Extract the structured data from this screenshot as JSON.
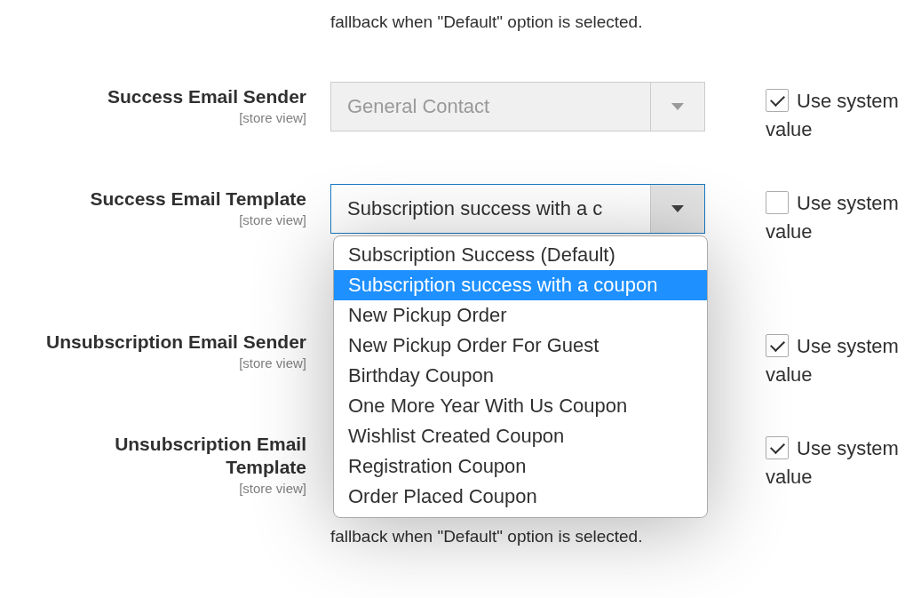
{
  "top_note": "fallback when \"Default\" option is selected.",
  "fields": [
    {
      "label": "Success Email Sender",
      "scope": "[store view]",
      "select": {
        "value": "General Contact",
        "disabled": true,
        "expanded": false
      },
      "use_system_label": "Use system value",
      "use_system": true
    },
    {
      "label": "Success Email Template",
      "scope": "[store view]",
      "select": {
        "value": "Subscription success with a c",
        "disabled": false,
        "expanded": true,
        "options": [
          {
            "label": "Subscription Success (Default)",
            "selected": false
          },
          {
            "label": "Subscription success with a coupon",
            "selected": true
          },
          {
            "label": "New Pickup Order",
            "selected": false
          },
          {
            "label": "New Pickup Order For Guest",
            "selected": false
          },
          {
            "label": "Birthday Coupon",
            "selected": false
          },
          {
            "label": "One More Year With Us Coupon",
            "selected": false
          },
          {
            "label": "Wishlist Created Coupon",
            "selected": false
          },
          {
            "label": "Registration Coupon",
            "selected": false
          },
          {
            "label": "Order Placed Coupon",
            "selected": false
          }
        ]
      },
      "use_system_label": "Use system value",
      "use_system": false
    },
    {
      "label": "Unsubscription Email Sender",
      "scope": "[store view]",
      "use_system_label": "Use system value",
      "use_system": true
    },
    {
      "label": "Unsubscription Email Template",
      "scope": "[store view]",
      "use_system_label": "Use system value",
      "use_system": true
    }
  ],
  "bottom_note": "fallback when \"Default\" option is selected."
}
